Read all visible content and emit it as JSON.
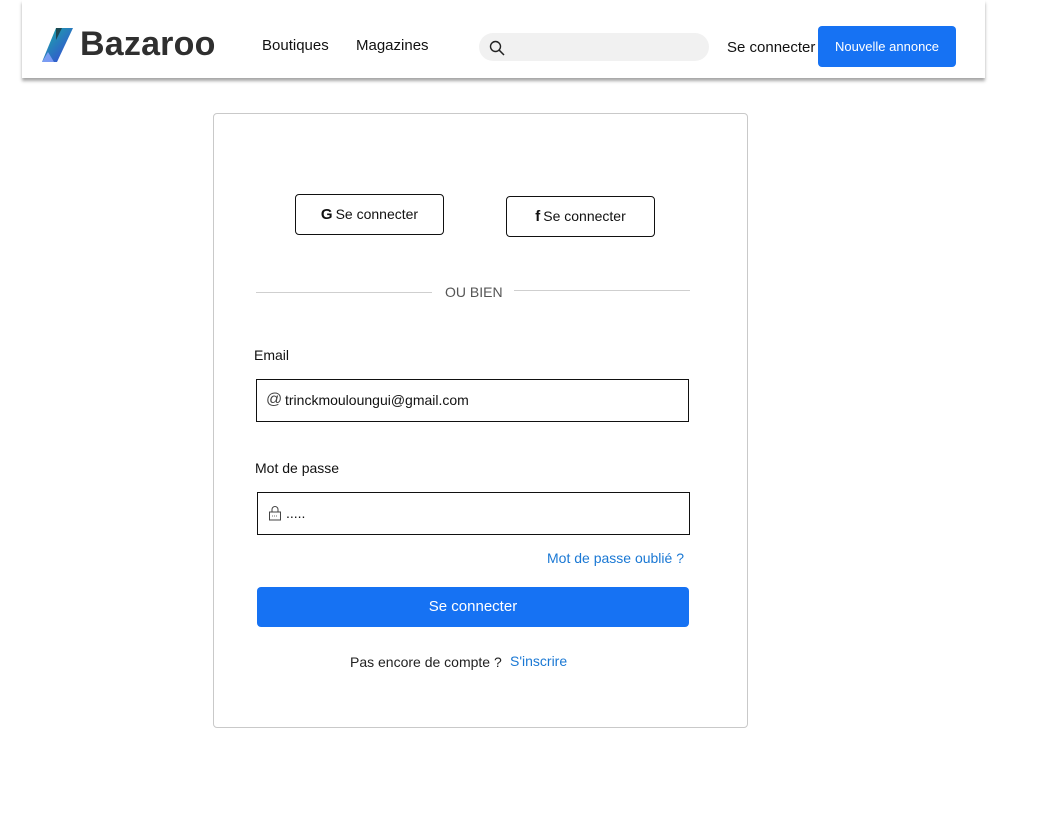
{
  "header": {
    "brand": "Bazaroo",
    "nav": [
      "Boutiques",
      "Magazines"
    ],
    "search_placeholder": "",
    "login_label": "Se connecter",
    "new_ad_label": "Nouvelle annonce"
  },
  "login_card": {
    "google_label": "Se connecter",
    "facebook_label": "Se connecter",
    "divider_text": "OU BIEN",
    "email_label": "Email",
    "email_value": "trinckmouloungui@gmail.com",
    "password_label": "Mot de passe",
    "password_value": ".....",
    "forgot_label": "Mot de passe oublié ?",
    "submit_label": "Se connecter",
    "no_account_text": "Pas encore de compte ?",
    "signup_label": "S'inscrire"
  },
  "colors": {
    "accent": "#1672f3",
    "link": "#1a78d4",
    "logo_blue": "#3a4fd6",
    "logo_teal": "#1aa7a0"
  }
}
